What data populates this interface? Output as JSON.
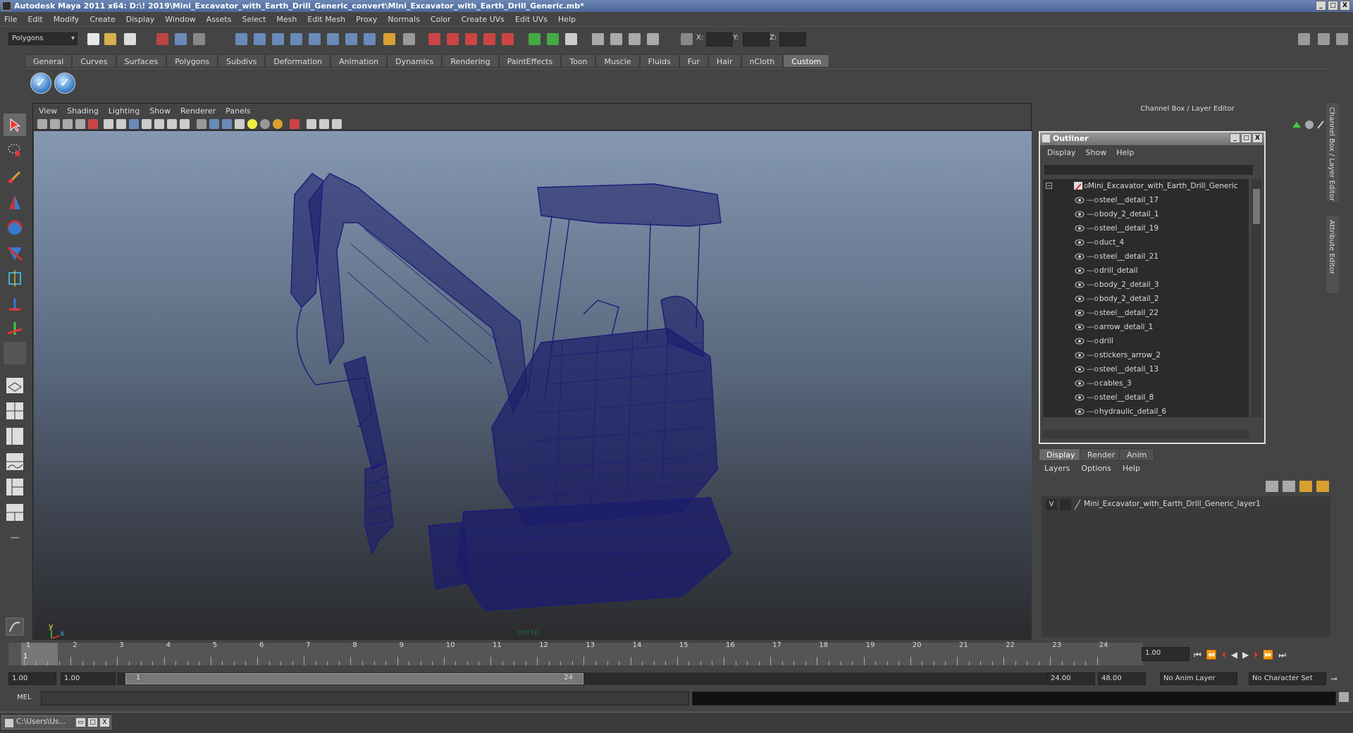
{
  "window": {
    "title": "Autodesk Maya 2011 x64: D:\\! 2019\\Mini_Excavator_with_Earth_Drill_Generic_convert\\Mini_Excavator_with_Earth_Drill_Generic.mb*",
    "buttons": [
      "_",
      "□",
      "X"
    ]
  },
  "menubar": [
    "File",
    "Edit",
    "Modify",
    "Create",
    "Display",
    "Window",
    "Assets",
    "Select",
    "Mesh",
    "Edit Mesh",
    "Proxy",
    "Normals",
    "Color",
    "Create UVs",
    "Edit UVs",
    "Help"
  ],
  "statusline": {
    "mode": "Polygons",
    "x_label": "X:",
    "y_label": "Y:",
    "z_label": "Z:"
  },
  "shelf": {
    "tabs": [
      "General",
      "Curves",
      "Surfaces",
      "Polygons",
      "Subdivs",
      "Deformation",
      "Animation",
      "Dynamics",
      "Rendering",
      "PaintEffects",
      "Toon",
      "Muscle",
      "Fluids",
      "Fur",
      "Hair",
      "nCloth",
      "Custom"
    ],
    "active_tab": "Custom"
  },
  "viewport": {
    "menu": [
      "View",
      "Shading",
      "Lighting",
      "Show",
      "Renderer",
      "Panels"
    ],
    "camera_label": "persp",
    "axis_y": "y",
    "axis_x": "x",
    "wireframe_color": "#1c1c78"
  },
  "channel_box": {
    "title": "Channel Box / Layer Editor",
    "side_tab_1": "Channel Box / Layer Editor",
    "side_tab_2": "Attribute Editor"
  },
  "outliner": {
    "title": "Outliner",
    "menu": [
      "Display",
      "Show",
      "Help"
    ],
    "root": "Mini_Excavator_with_Earth_Drill_Generic",
    "items": [
      "steel__detail_17",
      "body_2_detail_1",
      "steel__detail_19",
      "duct_4",
      "steel__detail_21",
      "drill_detail",
      "body_2_detail_3",
      "body_2_detail_2",
      "steel__detail_22",
      "arrow_detail_1",
      "drill",
      "stickers_arrow_2",
      "steel__detail_13",
      "cables_3",
      "steel__detail_8",
      "hydraulic_detail_6"
    ]
  },
  "layer_editor": {
    "tabs": [
      "Display",
      "Render",
      "Anim"
    ],
    "active_tab": "Display",
    "menu": [
      "Layers",
      "Options",
      "Help"
    ],
    "layer_visible": "V",
    "layer_name": "Mini_Excavator_with_Earth_Drill_Generic_layer1"
  },
  "timeline": {
    "ticks": [
      "1",
      "2",
      "3",
      "4",
      "5",
      "6",
      "7",
      "8",
      "9",
      "10",
      "11",
      "12",
      "13",
      "14",
      "15",
      "16",
      "17",
      "18",
      "19",
      "20",
      "21",
      "22",
      "23",
      "24"
    ],
    "current_frame_marker": "1",
    "current_time": "1.00"
  },
  "range": {
    "start": "1.00",
    "playback_start": "1.00",
    "slider_start": "1",
    "slider_end": "24",
    "playback_end": "24.00",
    "end": "48.00",
    "anim_layer": "No Anim Layer",
    "character_set": "No Character Set"
  },
  "command_line": {
    "label": "MEL"
  },
  "taskbar": {
    "item": "C:\\Users\\Us..."
  }
}
